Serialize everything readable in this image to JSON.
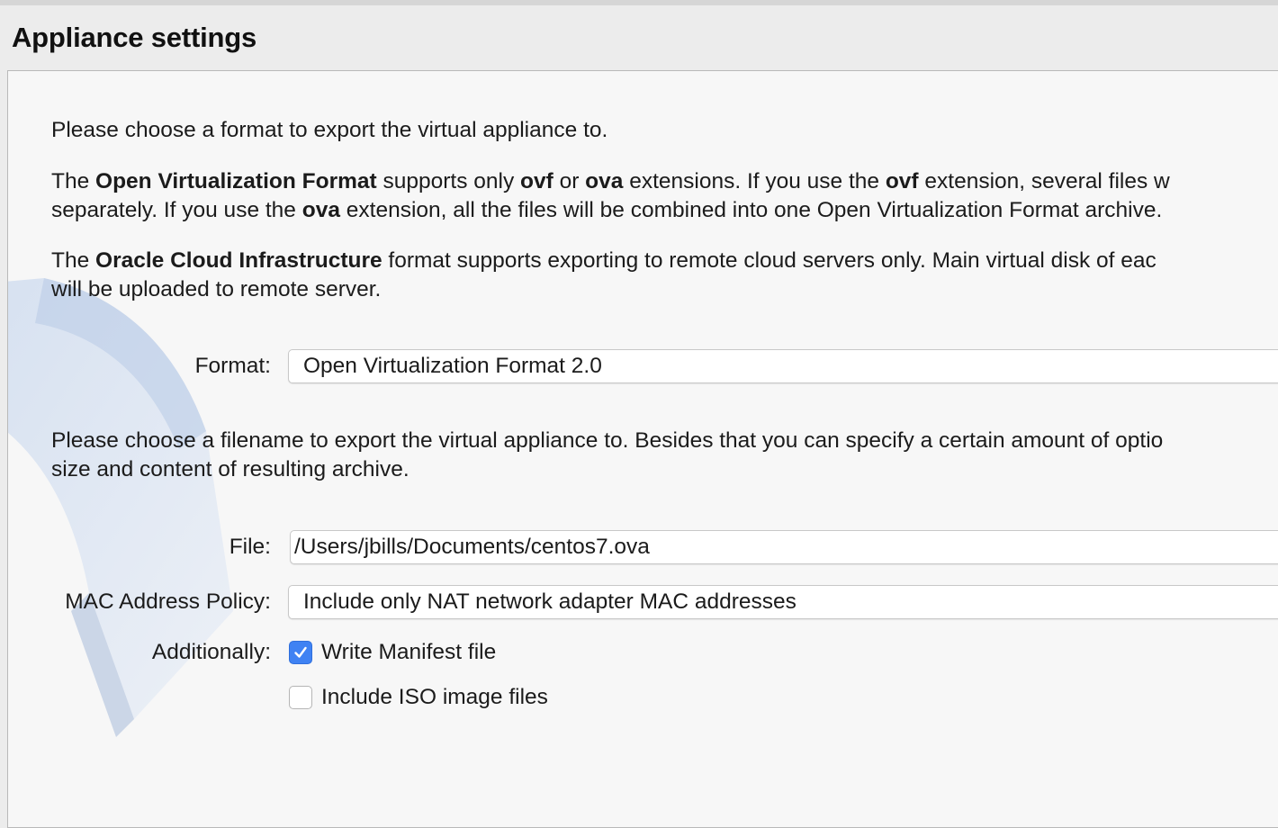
{
  "page": {
    "title": "Appliance settings"
  },
  "intro": {
    "line1": "Please choose a format to export the virtual appliance to."
  },
  "ovf_para": {
    "line1_p1": "The ",
    "line1_b1": "Open Virtualization Format",
    "line1_p2": " supports only ",
    "line1_b2": "ovf",
    "line1_p3": " or ",
    "line1_b3": "ova",
    "line1_p4": " extensions. If you use the ",
    "line1_b4": "ovf",
    "line1_p5": " extension, several files w",
    "line2_p1": "separately. If you use the ",
    "line2_b1": "ova",
    "line2_p2": " extension, all the files will be combined into one Open Virtualization Format archive."
  },
  "oci_para": {
    "line1_p1": "The ",
    "line1_b1": "Oracle Cloud Infrastructure",
    "line1_p2": " format supports exporting to remote cloud servers only. Main virtual disk of eac",
    "line2": "will be uploaded to remote server."
  },
  "format": {
    "label": "Format:",
    "value": "Open Virtualization Format 2.0"
  },
  "filename_para": {
    "line1": "Please choose a filename to export the virtual appliance to. Besides that you can specify a certain amount of optio",
    "line2": "size and content of resulting archive."
  },
  "file": {
    "label": "File:",
    "value": "/Users/jbills/Documents/centos7.ova"
  },
  "mac_policy": {
    "label": "MAC Address Policy:",
    "value": "Include only NAT network adapter MAC addresses"
  },
  "additionally": {
    "label": "Additionally:",
    "options": [
      {
        "label": "Write Manifest file",
        "checked": true
      },
      {
        "label": "Include ISO image files",
        "checked": false
      }
    ]
  },
  "colors": {
    "accent": "#3f82f3",
    "panel_bg": "#f7f7f7",
    "window_bg": "#ececec"
  },
  "icons": {
    "checkmark": "checkmark-icon",
    "watermark": "virtualbox-watermark-icon"
  }
}
